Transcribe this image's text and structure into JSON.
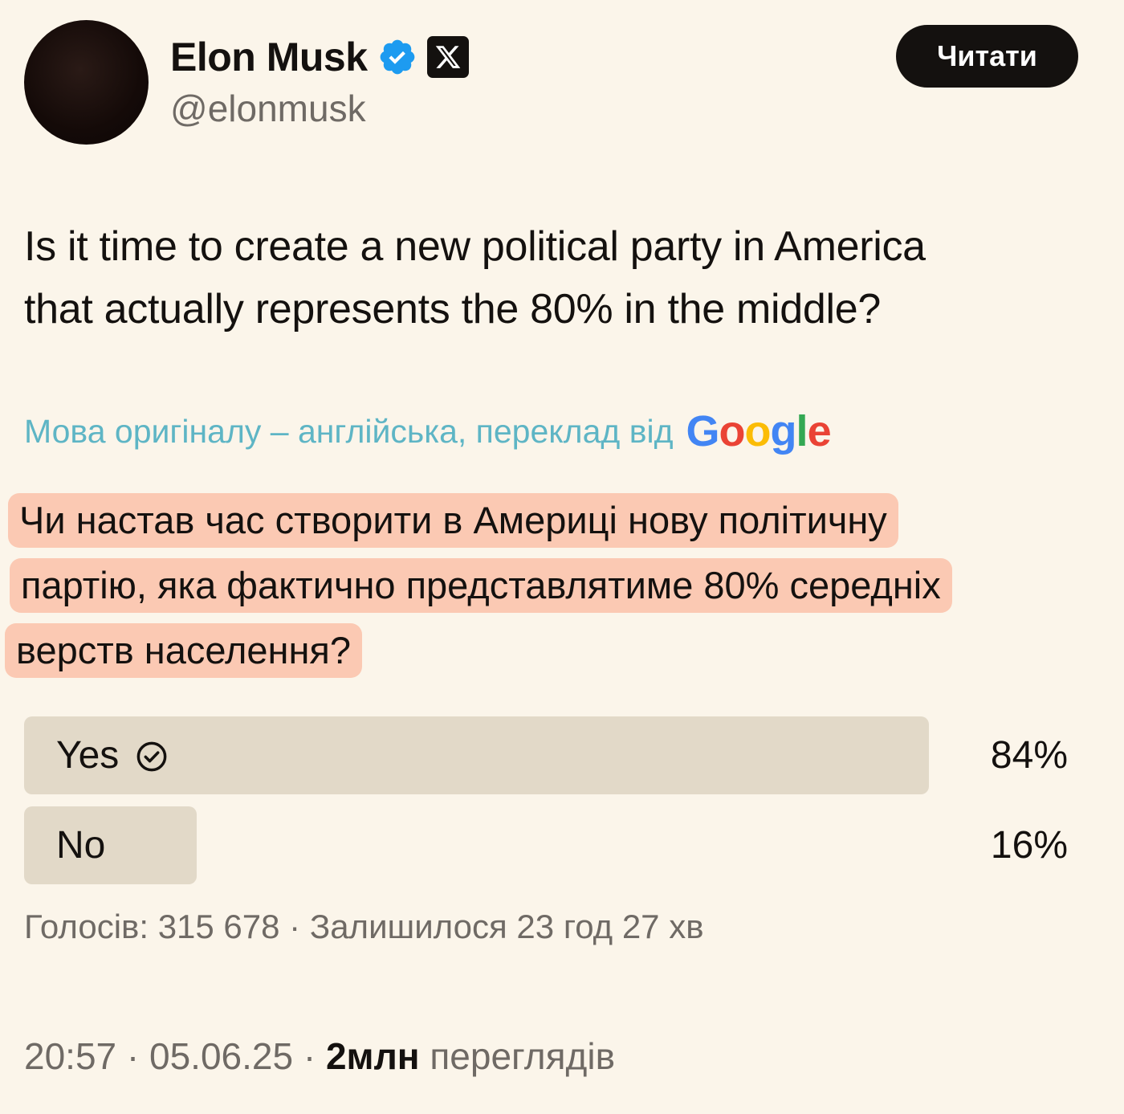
{
  "author": {
    "display_name": "Elon Musk",
    "handle": "@elonmusk"
  },
  "header": {
    "follow_label": "Читати"
  },
  "tweet": {
    "text_line1": "Is it time to create a new political party in America",
    "text_line2": "that actually represents the 80% in the middle?"
  },
  "translation": {
    "note": "Мова оригіналу – англійська, переклад від",
    "provider": "Google",
    "line1": "Чи настав час створити в Америці нову політичну",
    "line2": "партію, яка фактично представлятиме 80% середніх",
    "line3": "верств населення?"
  },
  "poll": {
    "options": [
      {
        "label": "Yes",
        "percent_text": "84%",
        "share": 0.84,
        "selected": true
      },
      {
        "label": "No",
        "percent_text": "16%",
        "share": 0.16,
        "selected": false
      }
    ],
    "meta": "Голосів: 315 678 · Залишилося 23 год 27 хв"
  },
  "footer": {
    "time": "20:57",
    "date": "05.06.25",
    "views_count": "2млн",
    "views_label": "переглядів",
    "separator": "·"
  },
  "colors": {
    "background": "#fbf5ea",
    "verified_badge": "#1d9bf0",
    "translation_note": "#5eb5c5",
    "highlight": "#fbc9b3",
    "poll_bar": "#e2d9c8",
    "google_blue": "#4285f4",
    "google_red": "#ea4335",
    "google_yellow": "#fbbc05",
    "google_green": "#34a853"
  },
  "icons": {
    "verified": "verified-badge-icon",
    "platform": "x-logo-icon",
    "poll_choice": "check-circle-icon"
  }
}
